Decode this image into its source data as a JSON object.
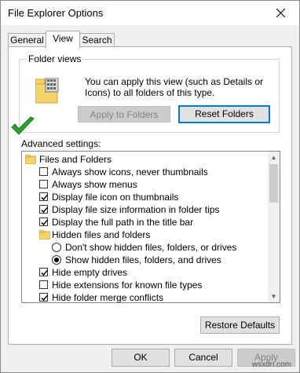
{
  "window": {
    "title": "File Explorer Options"
  },
  "tabs": [
    {
      "label": "General",
      "active": false
    },
    {
      "label": "View",
      "active": true
    },
    {
      "label": "Search",
      "active": false
    }
  ],
  "folder_views": {
    "group_label": "Folder views",
    "description": "You can apply this view (such as Details or Icons) to all folders of this type.",
    "apply_label": "Apply to Folders",
    "reset_label": "Reset Folders"
  },
  "advanced": {
    "label": "Advanced settings:",
    "items": [
      {
        "type": "folder",
        "label": "Files and Folders",
        "indent": 0
      },
      {
        "type": "checkbox",
        "label": "Always show icons, never thumbnails",
        "checked": false,
        "indent": 1
      },
      {
        "type": "checkbox",
        "label": "Always show menus",
        "checked": false,
        "indent": 1
      },
      {
        "type": "checkbox",
        "label": "Display file icon on thumbnails",
        "checked": true,
        "indent": 1
      },
      {
        "type": "checkbox",
        "label": "Display file size information in folder tips",
        "checked": true,
        "indent": 1
      },
      {
        "type": "checkbox",
        "label": "Display the full path in the title bar",
        "checked": true,
        "indent": 1
      },
      {
        "type": "folder",
        "label": "Hidden files and folders",
        "indent": 1
      },
      {
        "type": "radio",
        "label": "Don't show hidden files, folders, or drives",
        "checked": false,
        "indent": 2
      },
      {
        "type": "radio",
        "label": "Show hidden files, folders, and drives",
        "checked": true,
        "indent": 2
      },
      {
        "type": "checkbox",
        "label": "Hide empty drives",
        "checked": true,
        "indent": 1
      },
      {
        "type": "checkbox",
        "label": "Hide extensions for known file types",
        "checked": false,
        "indent": 1
      },
      {
        "type": "checkbox",
        "label": "Hide folder merge conflicts",
        "checked": true,
        "indent": 1
      }
    ]
  },
  "restore_defaults_label": "Restore Defaults",
  "buttons": {
    "ok": "OK",
    "cancel": "Cancel",
    "apply": "Apply"
  },
  "watermark": "wsxdn.com",
  "colors": {
    "accent": "#0078d7",
    "check_green": "#2e9e2e",
    "folder": "#f5d36b"
  }
}
